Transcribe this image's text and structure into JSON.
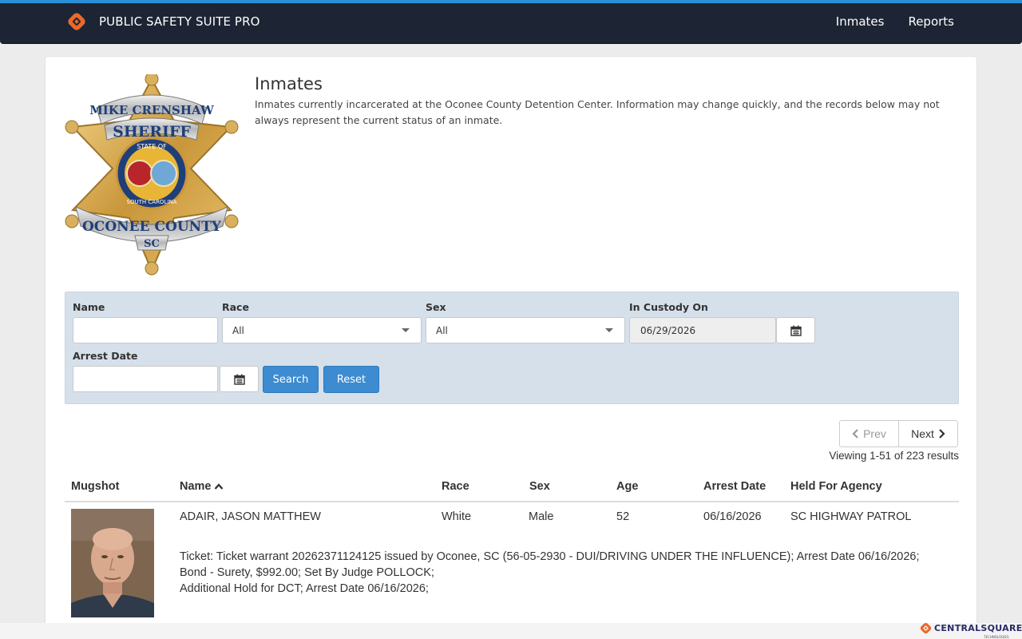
{
  "header": {
    "app_name": "PUBLIC SAFETY SUITE PRO",
    "nav": [
      {
        "label": "Inmates"
      },
      {
        "label": "Reports"
      }
    ]
  },
  "badge": {
    "top_ribbon": "MIKE CRENSHAW",
    "title": "SHERIFF",
    "seal_top": "STATE OF",
    "seal_bottom": "SOUTH CAROLINA",
    "bottom_ribbon": "OCONEE COUNTY",
    "state": "SC"
  },
  "intro": {
    "title": "Inmates",
    "description": "Inmates currently incarcerated at the Oconee County Detention Center. Information may change quickly, and the records below may not always represent the current status of an inmate."
  },
  "filters": {
    "name_label": "Name",
    "name_value": "",
    "race_label": "Race",
    "race_value": "All",
    "sex_label": "Sex",
    "sex_value": "All",
    "custody_label": "In Custody On",
    "custody_value": "06/29/2026",
    "arrest_label": "Arrest Date",
    "arrest_value": "",
    "search_label": "Search",
    "reset_label": "Reset"
  },
  "pagination": {
    "prev_label": "Prev",
    "next_label": "Next",
    "viewing": "Viewing 1-51 of 223 results"
  },
  "table": {
    "columns": [
      "Mugshot",
      "Name",
      "Race",
      "Sex",
      "Age",
      "Arrest Date",
      "Held For Agency"
    ],
    "sort_column": "Name",
    "rows": [
      {
        "name": "ADAIR, JASON MATTHEW",
        "race": "White",
        "sex": "Male",
        "age": "52",
        "arrest_date": "06/16/2026",
        "agency": "SC HIGHWAY PATROL",
        "charge_1": "Ticket: Ticket warrant 20262371124125 issued by Oconee, SC (56-05-2930 - DUI/DRIVING UNDER THE INFLUENCE); Arrest Date 06/16/2026; Bond - Surety, $992.00; Set By Judge POLLOCK;",
        "charge_2": "Additional Hold for DCT; Arrest Date 06/16/2026;"
      }
    ]
  },
  "footer": {
    "vendor": "CENTRALSQUARE",
    "vendor_sub": "TECHNOLOGIES"
  },
  "colors": {
    "topbar": "#1d2433",
    "accent": "#2b8fd6",
    "button": "#3d8bd0",
    "filter_bg": "#d5e0eb"
  },
  "icons": [
    "brand-logo-icon",
    "calendar-icon",
    "chevron-left-icon",
    "chevron-right-icon",
    "sort-asc-icon",
    "caret-down-icon"
  ]
}
